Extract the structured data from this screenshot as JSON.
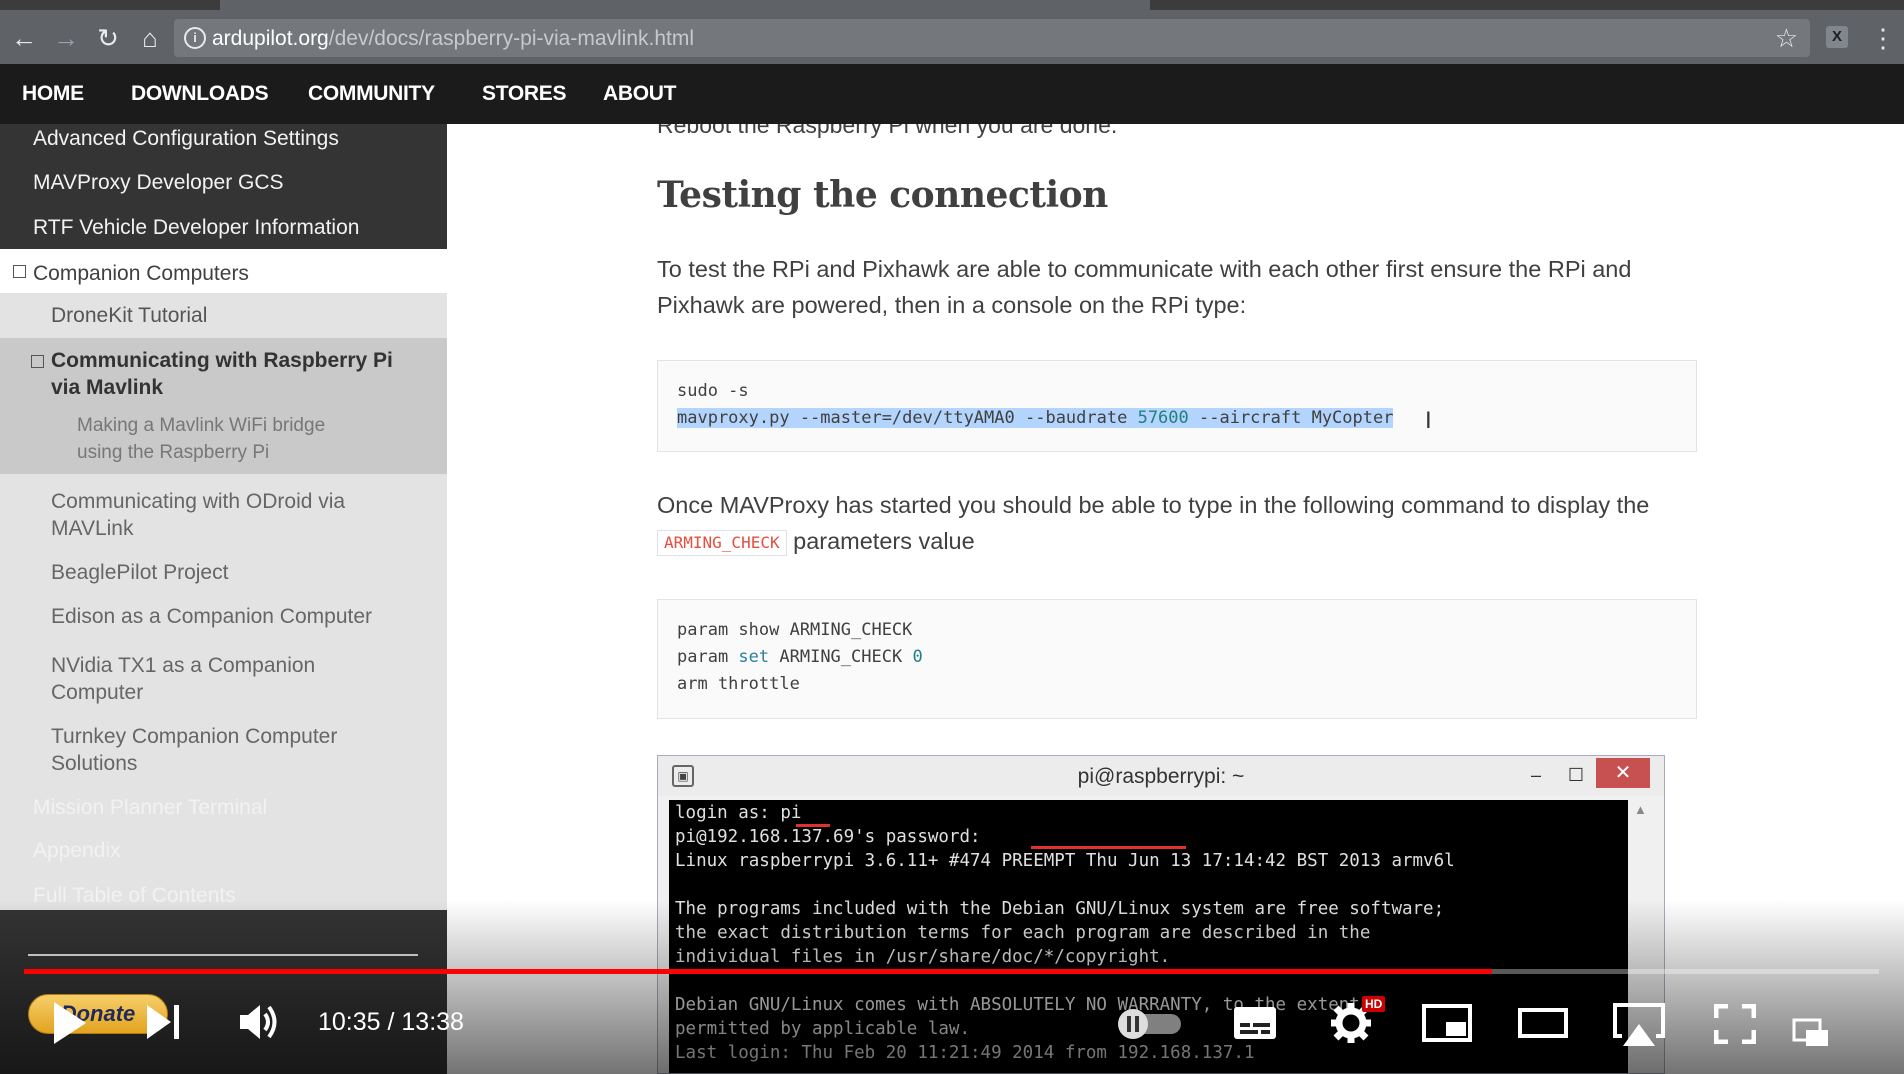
{
  "browser": {
    "url_host": "ardupilot.org",
    "url_path": "/dev/docs/raspberry-pi-via-mavlink.html",
    "ext_icon": "X"
  },
  "site_nav": [
    "HOME",
    "DOWNLOADS",
    "COMMUNITY",
    "STORES",
    "ABOUT"
  ],
  "sidebar": {
    "items": [
      {
        "label": "Advanced Configuration Settings"
      },
      {
        "label": "MAVProxy Developer GCS"
      },
      {
        "label": "RTF Vehicle Developer Information"
      },
      {
        "label": "Companion Computers",
        "box": "⊟"
      },
      {
        "label": "DroneKit Tutorial"
      },
      {
        "line1": "Communicating with Raspberry Pi",
        "line2": "via Mavlink",
        "box": "⊟"
      },
      {
        "line1": "Making a Mavlink WiFi bridge",
        "line2": "using the Raspberry Pi"
      },
      {
        "line1": "Communicating with ODroid via",
        "line2": "MAVLink"
      },
      {
        "label": "BeaglePilot Project"
      },
      {
        "label": "Edison as a Companion Computer"
      },
      {
        "line1": "NVidia TX1 as a Companion",
        "line2": "Computer"
      },
      {
        "line1": "Turnkey Companion Computer",
        "line2": "Solutions"
      },
      {
        "label": "Mission Planner Terminal"
      },
      {
        "label": "Appendix"
      },
      {
        "label": "Full Table of Contents"
      }
    ]
  },
  "main": {
    "cut_text": "Reboot the Raspberry Pi when you are done.",
    "heading": "Testing the connection",
    "para1_line1": "To test the RPi and Pixhawk are able to communicate with each other first ensure the RPi and",
    "para1_line2": "Pixhawk are powered, then in a console on the RPi type:",
    "code1_line1": "sudo -s",
    "code1_line2_a": "mavproxy.py --master=/dev/ttyAMA0 --baudrate ",
    "code1_line2_num": "57600",
    "code1_line2_b": " --aircraft MyCopter",
    "para2_line1": "Once MAVProxy has started you should be able to type in the following command to display the",
    "para2_code": "ARMING_CHECK",
    "para2_rest": " parameters value",
    "code2_line1": "param show ARMING_CHECK",
    "code2_line2_a": "param ",
    "code2_line2_kw": "set",
    "code2_line2_b": " ARMING_CHECK ",
    "code2_line2_num": "0",
    "code2_line3": "arm throttle"
  },
  "terminal": {
    "title": "pi@raspberrypi: ~",
    "minimize": "–",
    "maximize": "☐",
    "close": "✕",
    "lines": [
      "login as: pi",
      "pi@192.168.137.69's password:",
      "Linux raspberrypi 3.6.11+ #474 PREEMPT Thu Jun 13 17:14:42 BST 2013 armv6l",
      "",
      "The programs included with the Debian GNU/Linux system are free software;",
      "the exact distribution terms for each program are described in the",
      "individual files in /usr/share/doc/*/copyright.",
      "",
      "Debian GNU/Linux comes with ABSOLUTELY NO WARRANTY, to the extent",
      "permitted by applicable law.",
      "Last login: Thu Feb 20 11:21:49 2014 from 192.168.137.1"
    ]
  },
  "video": {
    "donate": "Donate",
    "time": "10:35 / 13:38",
    "progress_fraction": 0.7915,
    "hd_badge": "HD"
  }
}
